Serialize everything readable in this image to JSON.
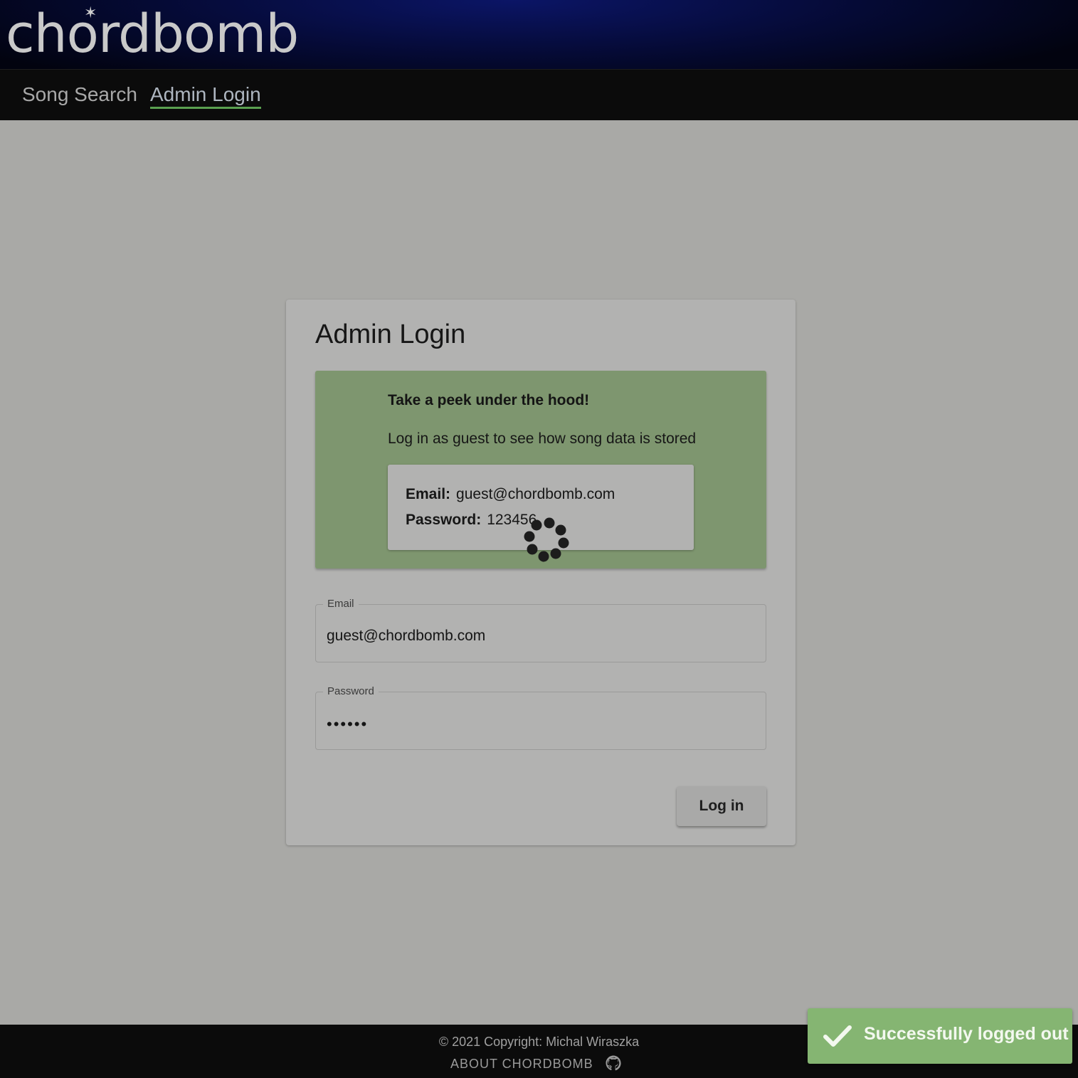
{
  "header": {
    "logo_text": "chordbomb"
  },
  "nav": {
    "items": [
      {
        "label": "Song Search",
        "active": false
      },
      {
        "label": "Admin Login",
        "active": true
      }
    ]
  },
  "card": {
    "title": "Admin Login",
    "info": {
      "heading": "Take a peek under the hood!",
      "body": "Log in as guest to see how song data is stored",
      "email_label": "Email:",
      "email_value": "guest@chordbomb.com",
      "password_label": "Password:",
      "password_value": "123456"
    },
    "email_field": {
      "label": "Email",
      "value": "guest@chordbomb.com"
    },
    "password_field": {
      "label": "Password",
      "masked_value": "••••••"
    },
    "login_button": "Log in"
  },
  "footer": {
    "copyright": "© 2021 Copyright: Michal Wiraszka",
    "about": "ABOUT CHORDBOMB"
  },
  "toast": {
    "message": "Successfully logged out"
  },
  "colors": {
    "accent_underline": "#5aa050",
    "info_bg": "#7e966f",
    "toast_bg": "#85b572"
  },
  "icons": {
    "spinner": "loading-spinner-icon",
    "check": "check-icon",
    "github": "github-icon"
  }
}
